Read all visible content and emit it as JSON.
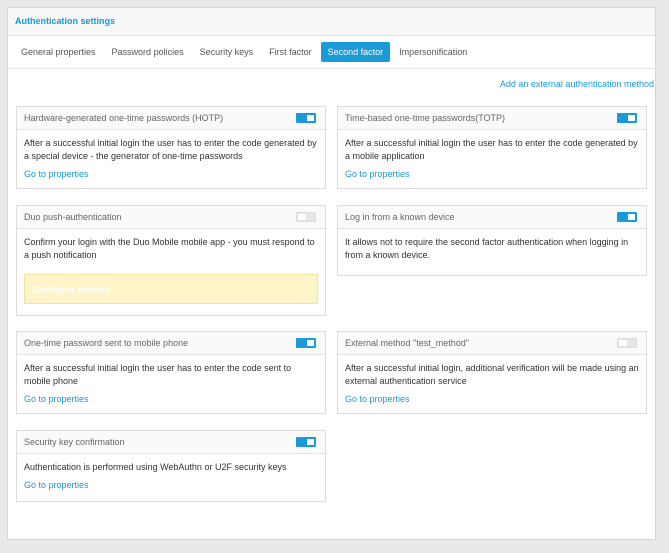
{
  "panel": {
    "title": "Authentication settings"
  },
  "tabs": [
    {
      "label": "General properties",
      "active": false
    },
    {
      "label": "Password policies",
      "active": false
    },
    {
      "label": "Security keys",
      "active": false
    },
    {
      "label": "First factor",
      "active": false
    },
    {
      "label": "Second factor",
      "active": true
    },
    {
      "label": "Impersonification",
      "active": false
    }
  ],
  "add_link": "Add an external authentication method",
  "cards": [
    {
      "title": "Hardware-generated one-time passwords (HOTP)",
      "enabled": true,
      "description": "After a successful initial login the user has to enter the code generated by a special device - the generator of one-time passwords",
      "link": "Go to properties"
    },
    {
      "title": "Time-based one-time passwords(TOTP)",
      "enabled": true,
      "description": "After a successful initial login the user has to enter the code generated by a mobile application",
      "link": "Go to properties"
    },
    {
      "title": "Duo push-authentication",
      "enabled": false,
      "description": "Confirm your login with the Duo Mobile mobile app - you must respond to a push notification",
      "button": "Configure method"
    },
    {
      "title": "Log in from a known device",
      "enabled": true,
      "description": "It allows not to require the second factor authentication when logging in from a known device."
    },
    {
      "title": "One-time password sent to mobile phone",
      "enabled": true,
      "description": "After a successful initial login the user has to enter the code sent to mobile phone",
      "link": "Go to properties"
    },
    {
      "title": "External method \"test_method\"",
      "enabled": false,
      "description": "After a successful initial login, additional verification will be made using an external authentication service",
      "link": "Go to properties"
    },
    {
      "title": "Security key confirmation",
      "enabled": true,
      "description": "Authentication is performed using WebAuthn or U2F security keys",
      "link": "Go to properties"
    }
  ],
  "colors": {
    "accent": "#1a9ad6",
    "toggle_off": "#e6e6e6",
    "warning_bg": "#fff3c8"
  }
}
